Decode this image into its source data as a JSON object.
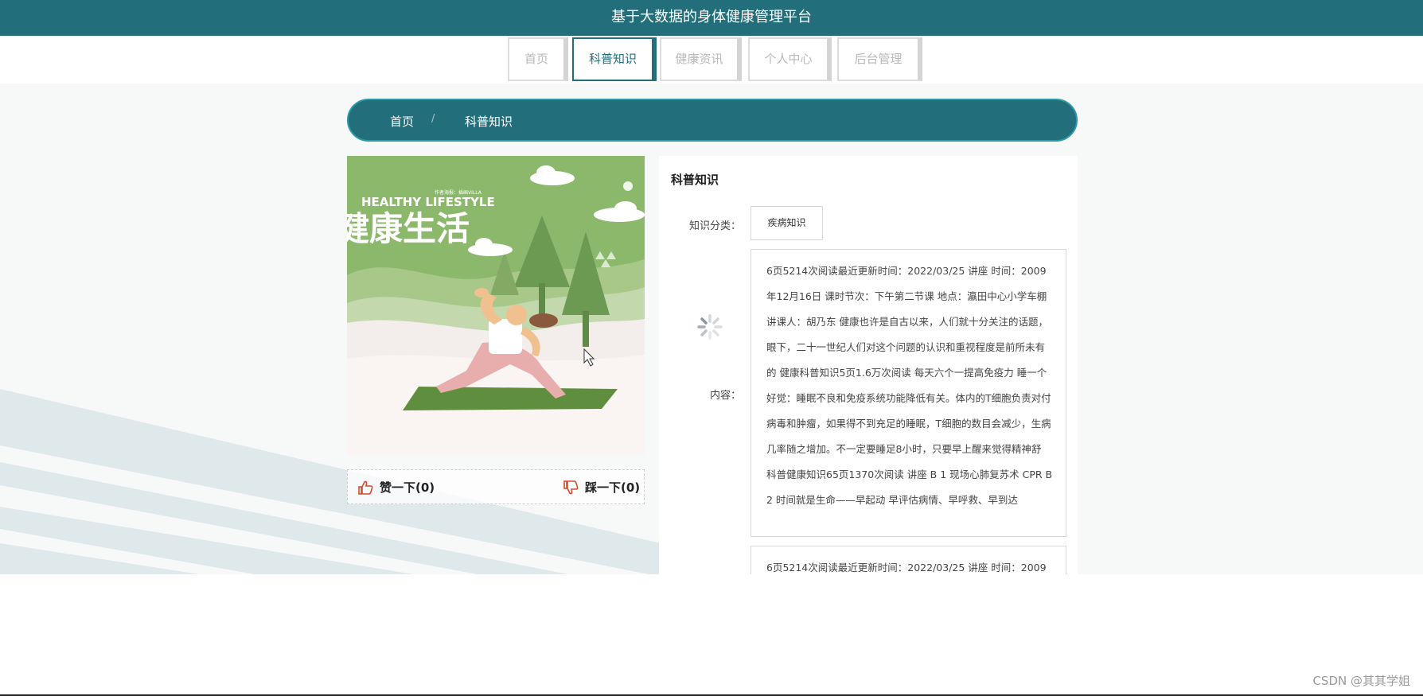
{
  "header": {
    "title": "基于大数据的身体健康管理平台"
  },
  "nav": {
    "items": [
      {
        "label": "首页"
      },
      {
        "label": "科普知识"
      },
      {
        "label": "健康资讯"
      },
      {
        "label": "个人中心"
      },
      {
        "label": "后台管理"
      }
    ],
    "active": "科普知识"
  },
  "breadcrumb": {
    "home": "首页",
    "separator": "/",
    "current": "科普知识"
  },
  "image": {
    "heading_en": "HEALTHY LIFESTYLE",
    "heading_cn": "健康生活",
    "credit": "作者海报：插画VILLA"
  },
  "vote": {
    "like_label": "赞一下(0)",
    "dislike_label": "踩一下(0)"
  },
  "detail": {
    "title": "科普知识",
    "category_label": "知识分类：",
    "category_value": "疾病知识",
    "content_label": "内容：",
    "content_text": "6页5214次阅读最近更新时间：2022/03/25 讲座 时间：2009年12月16日 课时节次：下午第二节课 地点：瀛田中心小学车棚 讲课人：胡乃东 健康也许是自古以来，人们就十分关注的话题，眼下，二十一世纪人们对这个问题的认识和重视程度是前所未有的 健康科普知识5页1.6万次阅读 每天六个一提高免疫力 睡一个好觉：睡眠不良和免疫系统功能降低有关。体内的T细胞负责对付病毒和肿瘤，如果得不到充足的睡眠，T细胞的数目会减少，生病几率随之增加。不一定要睡足8小时，只要早上醒来觉得精神舒 科普健康知识65页1370次阅读 讲座 B 1 现场心肺复苏术 CPR B 2 时间就是生命——早起动 早评估病情、早呼救、早到达",
    "content_text_2": "6页5214次阅读最近更新时间：2022/03/25 讲座 时间：2009"
  },
  "watermark": "CSDN @其其学姐",
  "colors": {
    "primary": "#226f7b",
    "like_icon": "#d94a2b"
  }
}
